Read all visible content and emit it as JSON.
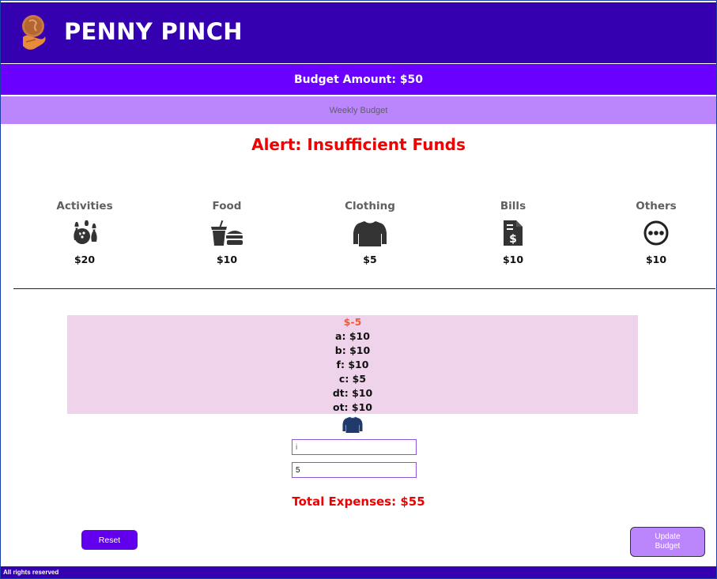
{
  "header": {
    "title": "PENNY PINCH",
    "logo_icon": "coin-hand-icon"
  },
  "budget": {
    "label": "Budget Amount: $50"
  },
  "period": {
    "label": "Weekly Budget"
  },
  "alert": {
    "text": "Alert: Insufficient Funds"
  },
  "categories": [
    {
      "name": "Activities",
      "amount": "$20",
      "icon": "bowling-icon"
    },
    {
      "name": "Food",
      "amount": "$10",
      "icon": "fast-food-icon"
    },
    {
      "name": "Clothing",
      "amount": "$5",
      "icon": "shirt-icon"
    },
    {
      "name": "Bills",
      "amount": "$10",
      "icon": "bill-file-icon"
    },
    {
      "name": "Others",
      "amount": "$10",
      "icon": "more-dots-icon"
    }
  ],
  "summary": {
    "remaining": "$-5",
    "lines": [
      "a: $10",
      "b: $10",
      "f: $10",
      "c: $5",
      "dt: $10",
      "ot: $10"
    ]
  },
  "form": {
    "selected_icon": "shirt-icon",
    "description_value": "",
    "description_placeholder": "i",
    "amount_value": "5"
  },
  "total": {
    "text": "Total Expenses: $55"
  },
  "buttons": {
    "reset": "Reset",
    "update": "Update\nBudget"
  },
  "footer": {
    "text": "All rights reserved"
  },
  "colors": {
    "header": "#3400b0",
    "budget_bar": "#6a00ff",
    "weekly_bar": "#bb86fc",
    "alert": "#f00000",
    "summary_bg": "#efd3ea",
    "remaining": "#f05a3a"
  }
}
